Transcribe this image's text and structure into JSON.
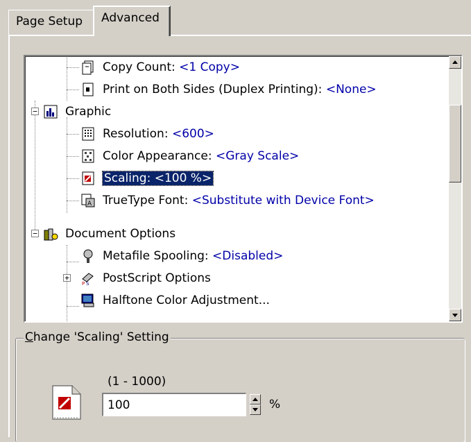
{
  "tabs": [
    {
      "label": "Page Setup",
      "active": false
    },
    {
      "label": "Advanced",
      "active": true
    }
  ],
  "tree": {
    "items": [
      {
        "label": "Copy Count: ",
        "value": "<1 Copy>",
        "icon": "copy-count-icon"
      },
      {
        "label": "Print on Both Sides (Duplex Printing): ",
        "value": "<None>",
        "icon": "duplex-icon"
      },
      {
        "label": "Graphic",
        "value": "",
        "icon": "graphic-icon",
        "expander": "−"
      },
      {
        "label": "Resolution: ",
        "value": "<600>",
        "icon": "resolution-icon"
      },
      {
        "label": "Color Appearance: ",
        "value": "<Gray Scale>",
        "icon": "color-appearance-icon"
      },
      {
        "label": "Scaling: ",
        "value": "<100 %>",
        "icon": "scaling-icon",
        "selected": true
      },
      {
        "label": "TrueType Font: ",
        "value": "<Substitute with Device Font>",
        "icon": "truetype-font-icon"
      },
      {
        "label": "Document Options",
        "value": "",
        "icon": "document-options-icon",
        "expander": "−"
      },
      {
        "label": "Metafile Spooling: ",
        "value": "<Disabled>",
        "icon": "metafile-spooling-icon"
      },
      {
        "label": "PostScript Options",
        "value": "",
        "icon": "postscript-options-icon",
        "expander": "+"
      },
      {
        "label": "Halftone Color Adjustment...",
        "value": "",
        "icon": "halftone-icon"
      }
    ]
  },
  "setting": {
    "group_prefix": "C",
    "group_rest": "hange 'Scaling' Setting",
    "range": "(1 - 1000)",
    "value": "100",
    "unit": "%"
  },
  "colors": {
    "face": "#d4d0c8",
    "selection": "#0a246a",
    "value_text": "#0000a8"
  }
}
